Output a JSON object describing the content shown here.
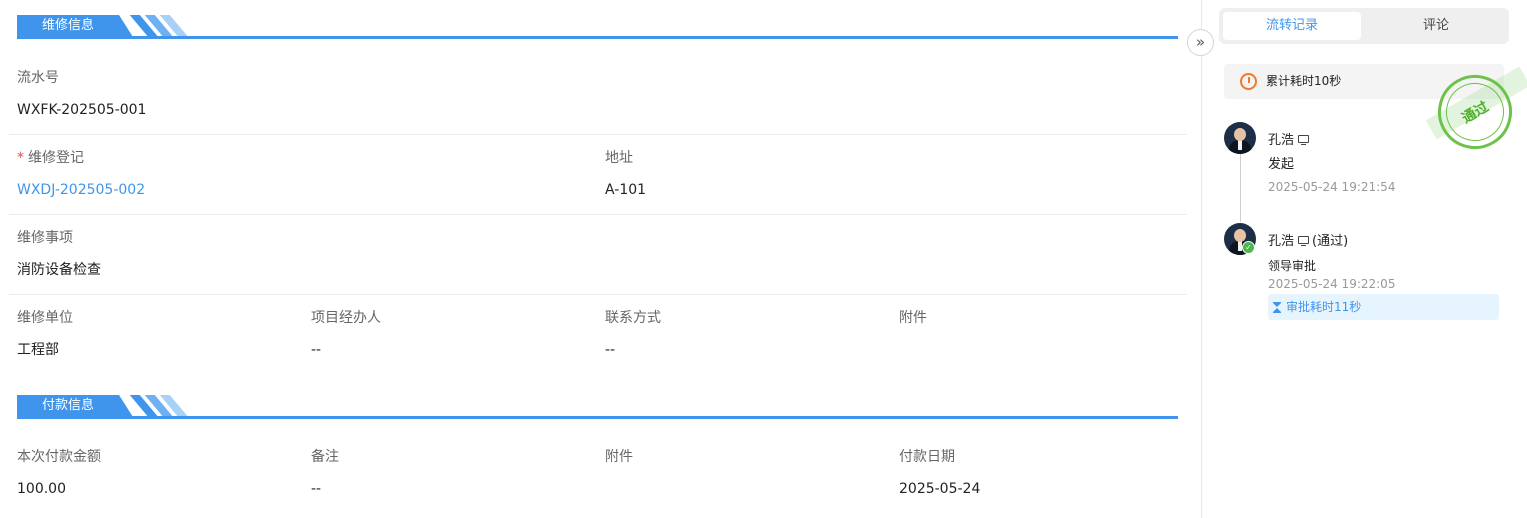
{
  "repair_section": {
    "title": "维修信息",
    "serial": {
      "label": "流水号",
      "value": "WXFK-202505-001"
    },
    "registration": {
      "required_mark": "*",
      "label": "维修登记",
      "value": "WXDJ-202505-002"
    },
    "address": {
      "label": "地址",
      "value": "A-101"
    },
    "item": {
      "label": "维修事项",
      "value": "消防设备检查"
    },
    "unit": {
      "label": "维修单位",
      "value": "工程部"
    },
    "manager": {
      "label": "项目经办人",
      "value": "--"
    },
    "contact": {
      "label": "联系方式",
      "value": "--"
    },
    "attachment": {
      "label": "附件",
      "value": ""
    }
  },
  "payment_section": {
    "title": "付款信息",
    "amount": {
      "label": "本次付款金额",
      "value": "100.00"
    },
    "remark": {
      "label": "备注",
      "value": "--"
    },
    "attachment": {
      "label": "附件",
      "value": ""
    },
    "date": {
      "label": "付款日期",
      "value": "2025-05-24"
    }
  },
  "sidebar": {
    "collapse_icon": "»",
    "tabs": [
      {
        "label": "流转记录",
        "active": true
      },
      {
        "label": "评论",
        "active": false
      }
    ],
    "total_time": "累计耗时10秒",
    "stamp": "通过",
    "timeline": [
      {
        "name": "孔浩",
        "status": "",
        "action": "发起",
        "time": "2025-05-24 19:21:54"
      },
      {
        "name": "孔浩",
        "status": "(通过)",
        "action": "领导审批",
        "time": "2025-05-24 19:22:05",
        "duration": "审批耗时11秒"
      }
    ]
  },
  "colors": {
    "accent": "#3f95ec",
    "stamp": "#6cc24a",
    "required": "#e5484d"
  }
}
